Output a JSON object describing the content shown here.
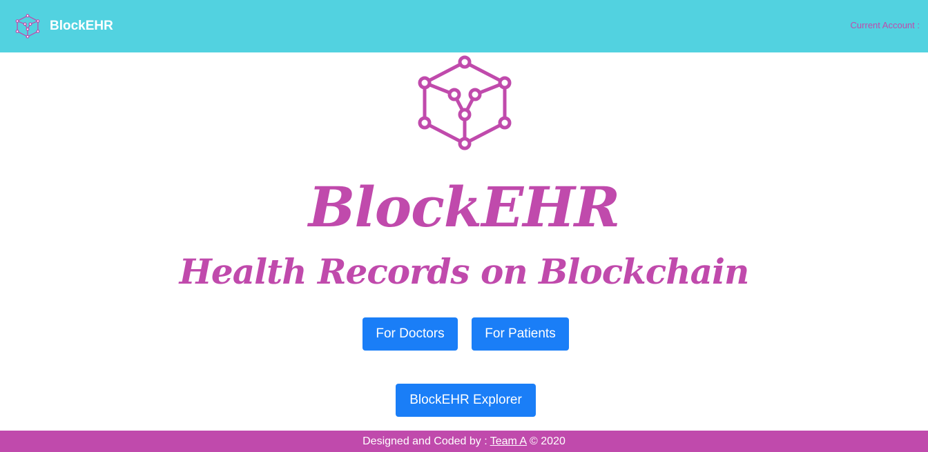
{
  "colors": {
    "navbar_bg": "#52d2e0",
    "brand_purple": "#c04aac",
    "button_blue": "#1a7ef7",
    "footer_bg": "#c04aac"
  },
  "navbar": {
    "brand_name": "BlockEHR",
    "brand_icon": "blockchain-cube-icon",
    "account_label": "Current Account :"
  },
  "hero": {
    "logo_icon": "blockchain-cube-icon",
    "title": "BlockEHR",
    "subtitle": "Health Records on Blockchain"
  },
  "buttons": {
    "doctors": "For Doctors",
    "patients": "For Patients",
    "explorer": "BlockEHR Explorer"
  },
  "footer": {
    "prefix": "Designed and Coded by :",
    "team_link": "Team A",
    "suffix": "© 2020"
  }
}
